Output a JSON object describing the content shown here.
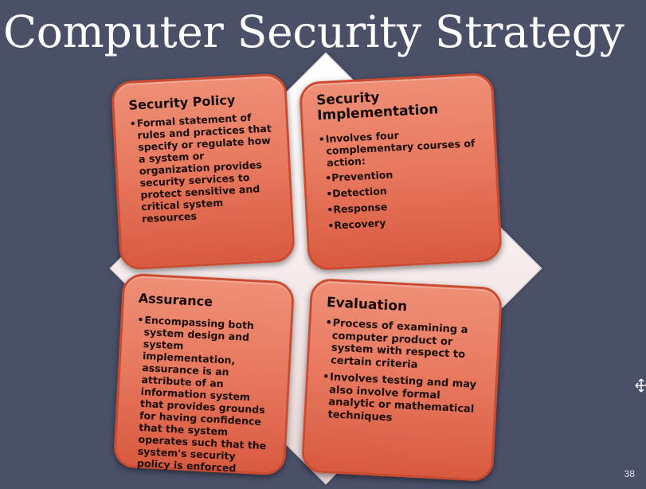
{
  "title": "Computer Security Strategy",
  "cards": {
    "policy": {
      "heading": "Security Policy",
      "bullets": [
        "Formal statement of rules and practices that specify or regulate how a system or organization provides security services to protect sensitive and critical system resources"
      ]
    },
    "implementation": {
      "heading": "Security Implementation",
      "bullets": [
        "Involves four complementary courses of action:"
      ],
      "sub_bullets": [
        "Prevention",
        "Detection",
        "Response",
        "Recovery"
      ]
    },
    "assurance": {
      "heading": "Assurance",
      "bullets": [
        "Encompassing both system design and system implementation, assurance is an attribute of an information system that provides grounds for having confidence that the system operates such that the system's security policy is enforced"
      ]
    },
    "evaluation": {
      "heading": "Evaluation",
      "bullets": [
        "Process of examining a computer product or system with respect to certain criteria",
        "Involves testing and may also involve formal analytic or mathematical techniques"
      ]
    }
  },
  "page_number": "38",
  "cursor_icon": "move-cursor-icon",
  "colors": {
    "background": "#4a5068",
    "card_fill": "#e87a60",
    "card_border": "#cc4b30",
    "diamond": "#f7eeee",
    "title": "#ffffff"
  }
}
